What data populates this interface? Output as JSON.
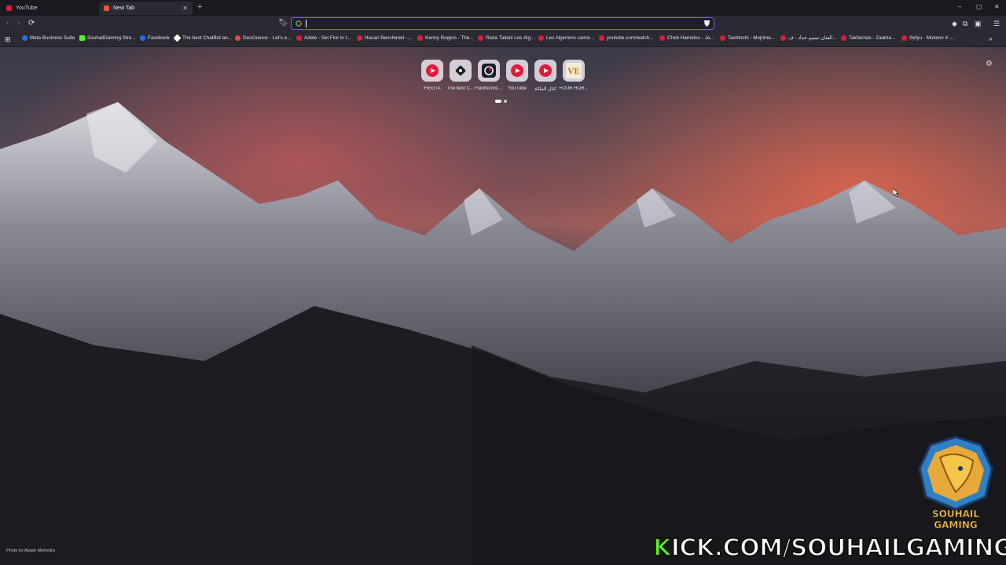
{
  "tabs": [
    {
      "title": "YouTube",
      "active": false,
      "icon": "youtube-icon"
    },
    {
      "title": "New Tab",
      "active": true,
      "icon": "brave-icon"
    }
  ],
  "window_controls": {
    "minimize": "–",
    "maximize": "▢",
    "close": "✕"
  },
  "toolbar": {
    "url_value": "",
    "url_placeholder": ""
  },
  "bookmarks": [
    {
      "label": "Meta Business Suite",
      "color": "#1877f2"
    },
    {
      "label": "SouhailGaming Stre...",
      "color": "#53fc18"
    },
    {
      "label": "Facebook",
      "color": "#1877f2"
    },
    {
      "label": "The best ChatBot an...",
      "color": "#ffffff"
    },
    {
      "label": "GeoGuessr - Let's e...",
      "color": "#e84545"
    },
    {
      "label": "Adele - Set Fire to t...",
      "color": "#e31b3a"
    },
    {
      "label": "Houari Benchenet -...",
      "color": "#e31b3a"
    },
    {
      "label": "Kenny Rogers - The...",
      "color": "#e31b3a"
    },
    {
      "label": "Reda Taliani Les Alg...",
      "color": "#e31b3a"
    },
    {
      "label": "Les Algeriens camic...",
      "color": "#e31b3a"
    },
    {
      "label": "youtube.com/watch...",
      "color": "#e31b3a"
    },
    {
      "label": "Cheb Hamidou - Ja...",
      "color": "#e31b3a"
    },
    {
      "label": "Tachtochi - Mojrima...",
      "color": "#e31b3a"
    },
    {
      "label": "الفنان نسيم حداد - ف...",
      "color": "#e31b3a"
    },
    {
      "label": "Takfarinas - Zaama...",
      "color": "#e31b3a"
    },
    {
      "label": "Sefyu - Molotov 4 -...",
      "color": "#e31b3a"
    }
  ],
  "speed_dial": [
    {
      "label": "FIEGTA",
      "icon": "youtube-icon"
    },
    {
      "label": "The best C...",
      "icon": "chatbot-icon"
    },
    {
      "label": "Flashscore....",
      "icon": "flashscore-icon"
    },
    {
      "label": "YouTube",
      "icon": "youtube-icon"
    },
    {
      "label": "كنال الملكة",
      "icon": "youtube-icon"
    },
    {
      "label": "FOUR HOR...",
      "icon": "fourhorsemen-icon"
    }
  ],
  "photo_credit": "Photo by Akash Mehrotra",
  "overlay": {
    "kick_url_k": "K",
    "kick_url_rest": "ICK.COM/SOUHAILGAMING",
    "logo_line1": "SOUHAIL",
    "logo_line2": "GAMING"
  },
  "colors": {
    "accent": "#7b5cf0",
    "youtube": "#e31b3a",
    "kick": "#53fc18"
  }
}
